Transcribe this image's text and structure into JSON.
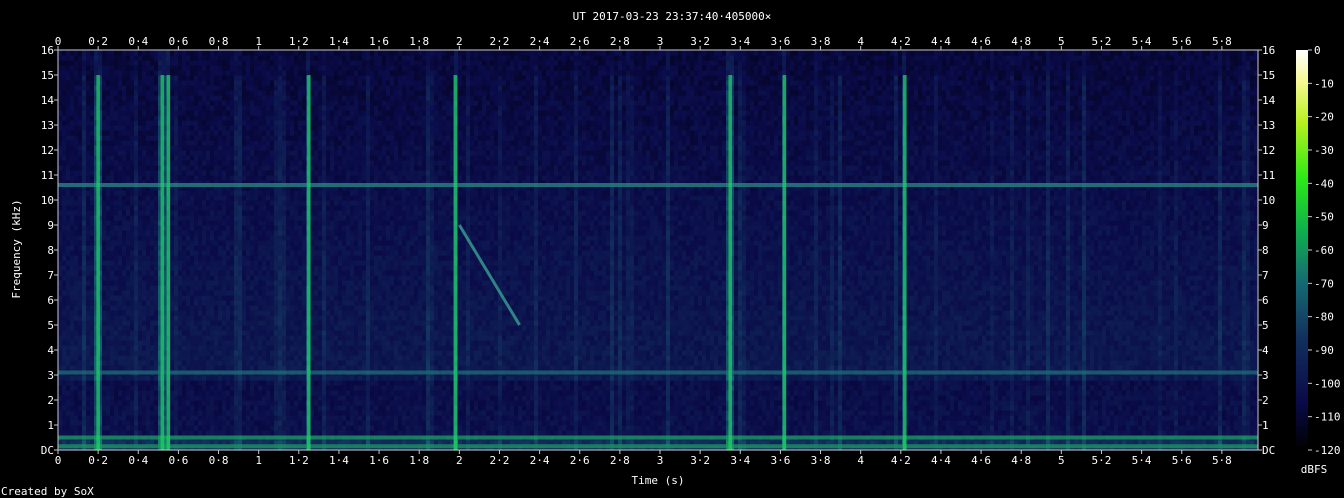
{
  "chart_data": {
    "type": "heatmap",
    "title": "UT 2017-03-23 23:37:40·405000×",
    "xlabel": "Time (s)",
    "ylabel": "Frequency (kHz)",
    "xlim": [
      0,
      5.98
    ],
    "ylim": [
      0,
      16
    ],
    "x_ticks": [
      "0",
      "0·2",
      "0·4",
      "0·6",
      "0·8",
      "1",
      "1·2",
      "1·4",
      "1·6",
      "1·8",
      "2",
      "2·2",
      "2·4",
      "2·6",
      "2·8",
      "3",
      "3·2",
      "3·4",
      "3·6",
      "3·8",
      "4",
      "4·2",
      "4·4",
      "4·6",
      "4·8",
      "5",
      "5·2",
      "5·4",
      "5·6",
      "5·8"
    ],
    "y_ticks": [
      "DC",
      "1",
      "2",
      "3",
      "4",
      "5",
      "6",
      "7",
      "8",
      "9",
      "10",
      "11",
      "12",
      "13",
      "14",
      "15",
      "16"
    ],
    "colorbar": {
      "label": "dBFS",
      "range": [
        -120,
        0
      ],
      "ticks": [
        "0",
        "-10",
        "-20",
        "-30",
        "-40",
        "-50",
        "-60",
        "-70",
        "-80",
        "-90",
        "-100",
        "-110",
        "-120"
      ]
    },
    "features": {
      "noise_floor_dbfs": -100,
      "hum_bands_khz": [
        0.15,
        0.5,
        3.1,
        10.6
      ],
      "strong_clicks_s": [
        0.2,
        0.52,
        0.55,
        1.25,
        1.98,
        3.35,
        3.62,
        4.22
      ],
      "sweep": {
        "t_start": 2.0,
        "t_end": 2.3,
        "f_start_khz": 9.0,
        "f_end_khz": 5.0
      }
    }
  },
  "footer": {
    "credit": "Created by SoX"
  },
  "colors": {
    "background": "#000000",
    "text": "#ffffff",
    "axis": "#c8c8c8"
  }
}
